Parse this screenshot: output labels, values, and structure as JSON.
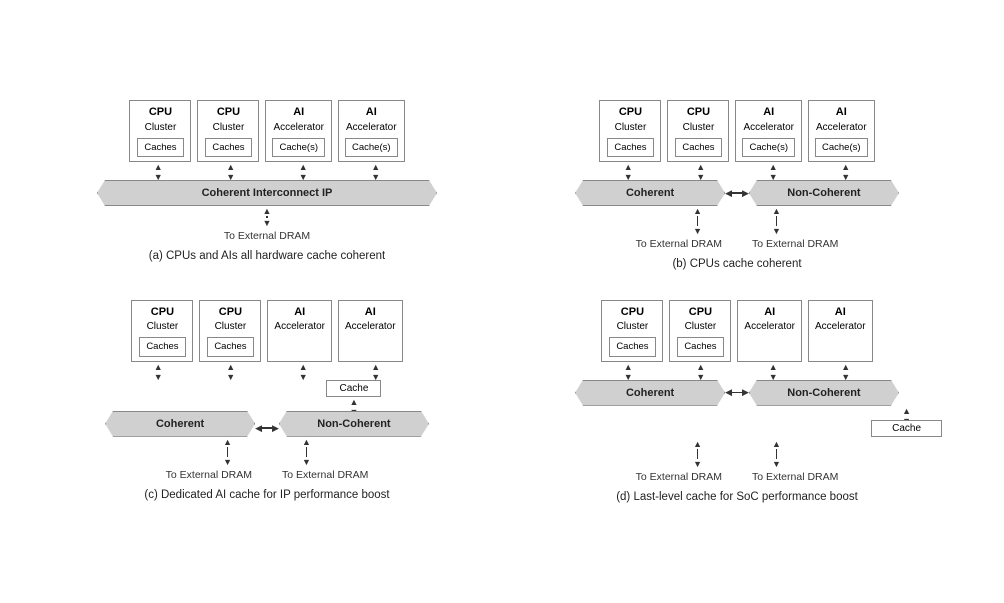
{
  "diagrams": [
    {
      "id": "a",
      "caption": "(a) CPUs and AIs all hardware cache coherent",
      "type": "single-banner",
      "nodes": [
        {
          "title": "CPU",
          "sub": "Cluster",
          "cache": "Caches"
        },
        {
          "title": "CPU",
          "sub": "Cluster",
          "cache": "Caches"
        },
        {
          "title": "AI",
          "sub": "Accelerator",
          "cache": "Cache(s)"
        },
        {
          "title": "AI",
          "sub": "Accelerator",
          "cache": "Cache(s)"
        }
      ],
      "banner": "Coherent Interconnect IP",
      "dram": [
        "To External DRAM"
      ]
    },
    {
      "id": "b",
      "caption": "(b) CPUs cache coherent",
      "type": "dual-banner",
      "left_nodes": [
        {
          "title": "CPU",
          "sub": "Cluster",
          "cache": "Caches"
        },
        {
          "title": "CPU",
          "sub": "Cluster",
          "cache": "Caches"
        }
      ],
      "right_nodes": [
        {
          "title": "AI",
          "sub": "Accelerator",
          "cache": "Cache(s)"
        },
        {
          "title": "AI",
          "sub": "Accelerator",
          "cache": "Cache(s)"
        }
      ],
      "left_banner": "Coherent",
      "right_banner": "Non-Coherent",
      "left_dram": "To External DRAM",
      "right_dram": "To External DRAM"
    },
    {
      "id": "c",
      "caption": "(c) Dedicated AI cache for IP performance boost",
      "type": "dual-banner-cache",
      "left_nodes": [
        {
          "title": "CPU",
          "sub": "Cluster",
          "cache": "Caches"
        },
        {
          "title": "CPU",
          "sub": "Cluster",
          "cache": "Caches"
        }
      ],
      "right_nodes": [
        {
          "title": "AI",
          "sub": "Accelerator",
          "cache": null
        },
        {
          "title": "AI",
          "sub": "Accelerator",
          "cache": null
        }
      ],
      "mid_cache": "Cache",
      "left_banner": "Coherent",
      "right_banner": "Non-Coherent",
      "left_dram": "To External DRAM",
      "right_dram": "To External DRAM"
    },
    {
      "id": "d",
      "caption": "(d) Last-level cache for SoC performance boost",
      "type": "dual-banner-cache-below",
      "left_nodes": [
        {
          "title": "CPU",
          "sub": "Cluster",
          "cache": "Caches"
        },
        {
          "title": "CPU",
          "sub": "Cluster",
          "cache": "Caches"
        }
      ],
      "right_nodes": [
        {
          "title": "AI",
          "sub": "Accelerator",
          "cache": null
        },
        {
          "title": "AI",
          "sub": "Accelerator",
          "cache": null
        }
      ],
      "mid_cache": "Cache",
      "left_banner": "Coherent",
      "right_banner": "Non-Coherent",
      "left_dram": "To External DRAM",
      "right_dram": "To External DRAM"
    }
  ],
  "icons": {
    "arrow_up": "▲",
    "arrow_down": "▼",
    "arrow_left": "◀",
    "arrow_right": "▶"
  }
}
